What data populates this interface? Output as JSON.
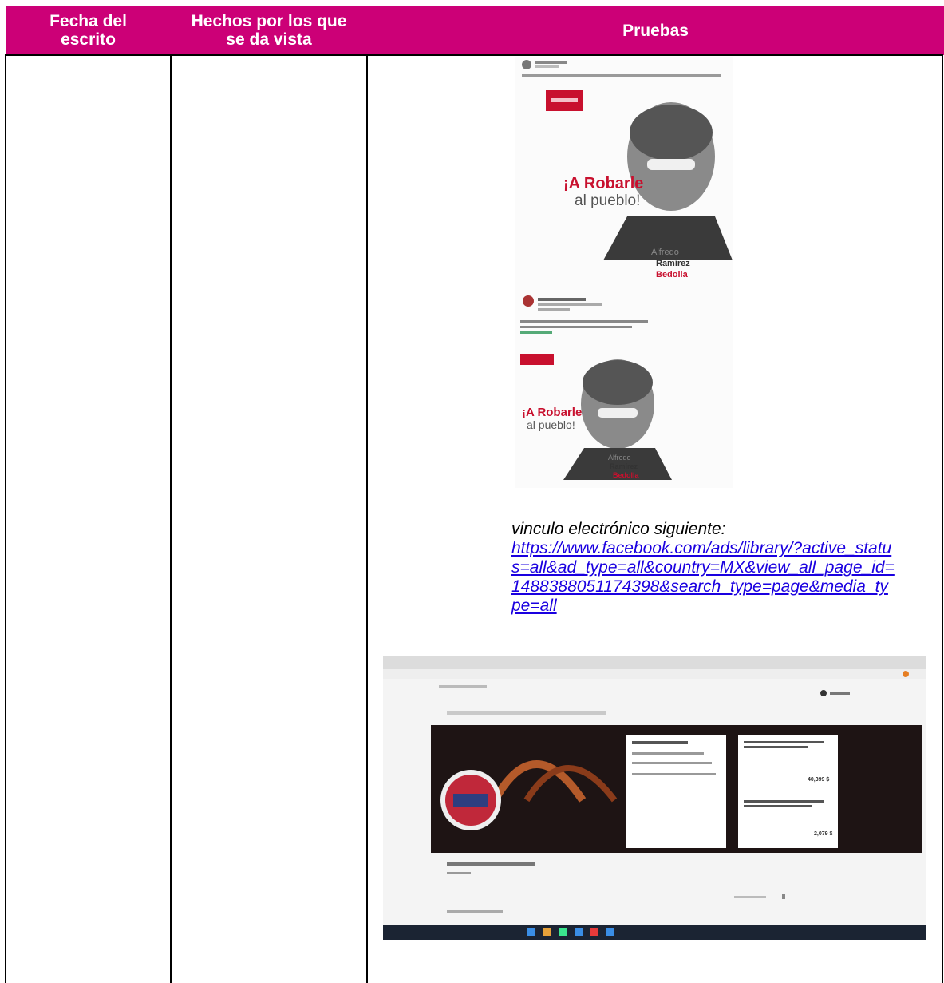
{
  "table": {
    "headers": [
      "Fecha del escrito",
      "Hechos por los que se da vista",
      "Pruebas"
    ]
  },
  "evidence": {
    "post_top": {
      "slogan_line1": "¡A Robarle",
      "slogan_line2": "al pueblo!",
      "name_line1": "Alfredo",
      "name_line2": "Ramírez",
      "name_line3": "Bedolla"
    },
    "post_bottom": {
      "slogan_line1": "¡A Robarle",
      "slogan_line2": "al pueblo!",
      "name_line1": "Alfredo",
      "name_line2": "Ramírez",
      "name_line3": "Bedolla"
    },
    "caption": "vinculo electrónico siguiente:",
    "link_text": "https://www.facebook.com/ads/library/?active_status=all&ad_type=all&country=MX&view_all_page_id=1488388051174398&search_type=page&media_type=all",
    "screenshot": {
      "amount_1": "40,399 $",
      "amount_2": "2,079 $"
    }
  },
  "colors": {
    "header_bg": "#cc0077",
    "header_text": "#ffffff",
    "link": "#1a00e0",
    "accent_red": "#c8102e"
  }
}
